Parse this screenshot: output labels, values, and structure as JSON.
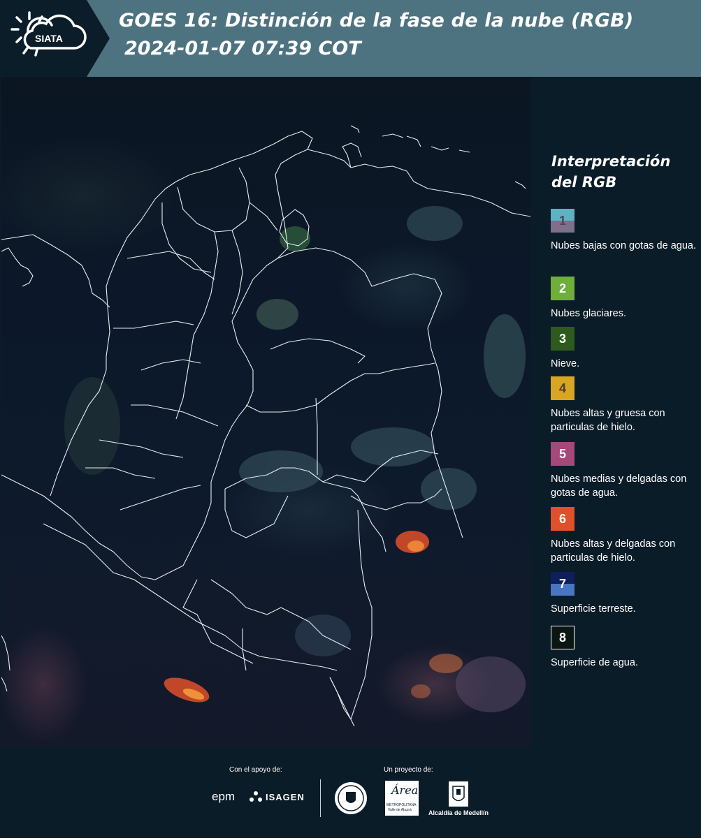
{
  "header": {
    "logo_text": "SIATA",
    "title": "GOES 16: Distinción de la fase de la nube (RGB)",
    "timestamp": "2024-01-07 07:39 COT"
  },
  "legend": {
    "title_line1": "Interpretación",
    "title_line2": "del RGB",
    "items": [
      {
        "number": "1",
        "label": "Nubes bajas con gotas de agua.",
        "colors": [
          "#5fb2c4",
          "#7e6f8c"
        ],
        "number_color": "#4a4a55"
      },
      {
        "number": "2",
        "label": "Nubes glaciares.",
        "colors": [
          "#6fae3a"
        ],
        "number_color": "#ffffff"
      },
      {
        "number": "3",
        "label": "Nieve.",
        "colors": [
          "#2e5a1d"
        ],
        "number_color": "#ffffff"
      },
      {
        "number": "4",
        "label": "Nubes altas y gruesa con particulas de hielo.",
        "colors": [
          "#d8a623"
        ],
        "number_color": "#4a4030"
      },
      {
        "number": "5",
        "label": "Nubes medias y delgadas con gotas de agua.",
        "colors": [
          "#a5487a"
        ],
        "number_color": "#ffffff"
      },
      {
        "number": "6",
        "label": "Nubes altas y delgadas con particulas de hielo.",
        "colors": [
          "#e0502b"
        ],
        "number_color": "#ffffff"
      },
      {
        "number": "7",
        "label": "Superficie terreste.",
        "colors": [
          "#0f1f5c",
          "#4a74c4"
        ],
        "number_color": "#ffffff"
      },
      {
        "number": "8",
        "label": "Superficie de agua.",
        "colors": [
          "#0b1511"
        ],
        "number_color": "#ffffff"
      }
    ]
  },
  "footer": {
    "support_label": "Con el apoyo de:",
    "project_label": "Un proyecto de:",
    "logos": {
      "epm": "epm",
      "isagen": "ISAGEN",
      "area_line1": "Área",
      "area_line2": "METROPOLITANA",
      "area_line3": "Valle de Aburrá",
      "alcaldia": "Alcaldía de Medellín"
    }
  }
}
